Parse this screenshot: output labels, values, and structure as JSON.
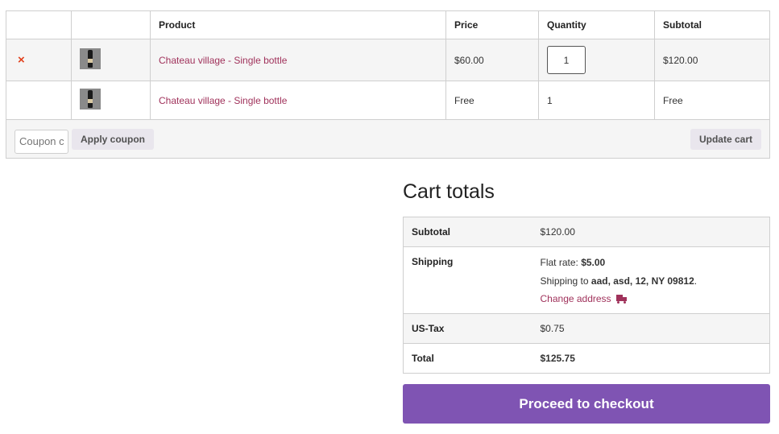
{
  "cart": {
    "headers": {
      "remove": "",
      "thumbnail": "",
      "product": "Product",
      "price": "Price",
      "quantity": "Quantity",
      "subtotal": "Subtotal"
    },
    "items": [
      {
        "remove_label": "×",
        "product": "Chateau village - Single bottle",
        "price": "$60.00",
        "quantity": "1",
        "subtotal": "$120.00"
      },
      {
        "remove_label": "",
        "product": "Chateau village - Single bottle",
        "price": "Free",
        "quantity": "1",
        "subtotal": "Free"
      }
    ],
    "coupon_placeholder": "Coupon code",
    "apply_coupon_label": "Apply coupon",
    "update_cart_label": "Update cart"
  },
  "totals": {
    "title": "Cart totals",
    "subtotal_label": "Subtotal",
    "subtotal_value": "$120.00",
    "shipping_label": "Shipping",
    "shipping_method": "Flat rate:",
    "shipping_rate": "$5.00",
    "shipping_to_prefix": "Shipping to",
    "shipping_address": "aad, asd, 12, NY 09812",
    "shipping_to_suffix": ".",
    "change_address_label": "Change address",
    "tax_label": "US-Tax",
    "tax_value": "$0.75",
    "total_label": "Total",
    "total_value": "$125.75"
  },
  "checkout_label": "Proceed to checkout",
  "colors": {
    "accent": "#7f54b3",
    "link": "#a0325b",
    "remove": "#e2401c"
  },
  "icons": {
    "remove": "close-icon",
    "change_address": "truck-icon"
  }
}
